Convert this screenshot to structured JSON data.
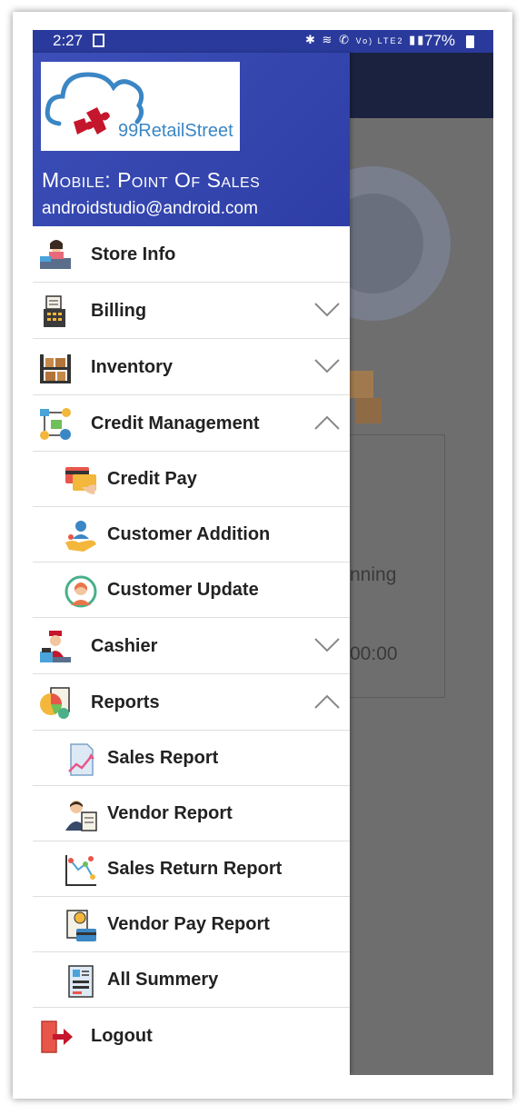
{
  "status_bar": {
    "time": "2:27",
    "signal_text": "Vo) LTE2",
    "battery": "77%"
  },
  "background": {
    "text_running": "nning",
    "text_time": "00:00"
  },
  "header": {
    "logo_text": "99RetailStreet",
    "app_name": "Mobile: Point Of Sales",
    "email": "androidstudio@android.com"
  },
  "menu": {
    "store_info": "Store Info",
    "billing": "Billing",
    "inventory": "Inventory",
    "credit_management": "Credit Management",
    "credit_pay": "Credit Pay",
    "customer_addition": "Customer Addition",
    "customer_update": "Customer Update",
    "cashier": "Cashier",
    "reports": "Reports",
    "sales_report": "Sales Report",
    "vendor_report": "Vendor Report",
    "sales_return_report": "Sales Return Report",
    "vendor_pay_report": "Vendor Pay Report",
    "all_summery": "All Summery",
    "logout": "Logout"
  },
  "colors": {
    "header_gradient": "#3c4fb8",
    "status_bar": "#2a3a9c",
    "scrim": "#6e6e6e",
    "logo_cloud": "#3b86c4",
    "logo_puzzle": "#c4162c"
  },
  "icons": [
    "cashier-desk-icon",
    "cash-register-icon",
    "warehouse-shelf-icon",
    "credit-network-icon",
    "credit-card-icon",
    "customer-add-icon",
    "customer-support-icon",
    "cashier-person-icon",
    "pie-report-icon",
    "sales-chart-icon",
    "vendor-report-icon",
    "scatter-chart-icon",
    "pay-report-icon",
    "summary-doc-icon",
    "logout-door-icon",
    "chevron-down-icon",
    "chevron-up-icon"
  ]
}
